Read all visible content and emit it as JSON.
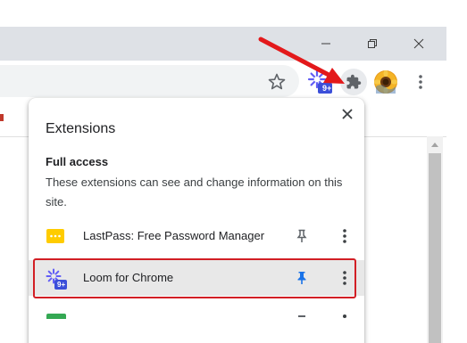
{
  "window": {
    "controls": {
      "minimize": "minimize-icon",
      "restore": "restore-icon",
      "close": "close-icon"
    }
  },
  "toolbar": {
    "icons": [
      "star-icon",
      "loom-extension-icon",
      "puzzle-piece-icon",
      "profile-avatar",
      "more-vert-icon"
    ],
    "loom_badge": "9+"
  },
  "popup": {
    "title": "Extensions",
    "section_heading": "Full access",
    "section_description": "These extensions can see and change information on this site.",
    "extensions": [
      {
        "name": "LastPass: Free Password Manager",
        "pinned": false
      },
      {
        "name": "Loom for Chrome",
        "pinned": true,
        "badge": "9+"
      }
    ]
  },
  "colors": {
    "titlebar": "#dee1e6",
    "pin_active": "#1a73e8",
    "highlight": "#d21f25",
    "arrow": "#e3191b",
    "lastpass": "#ffcc00",
    "loom_purple": "#625df5"
  }
}
